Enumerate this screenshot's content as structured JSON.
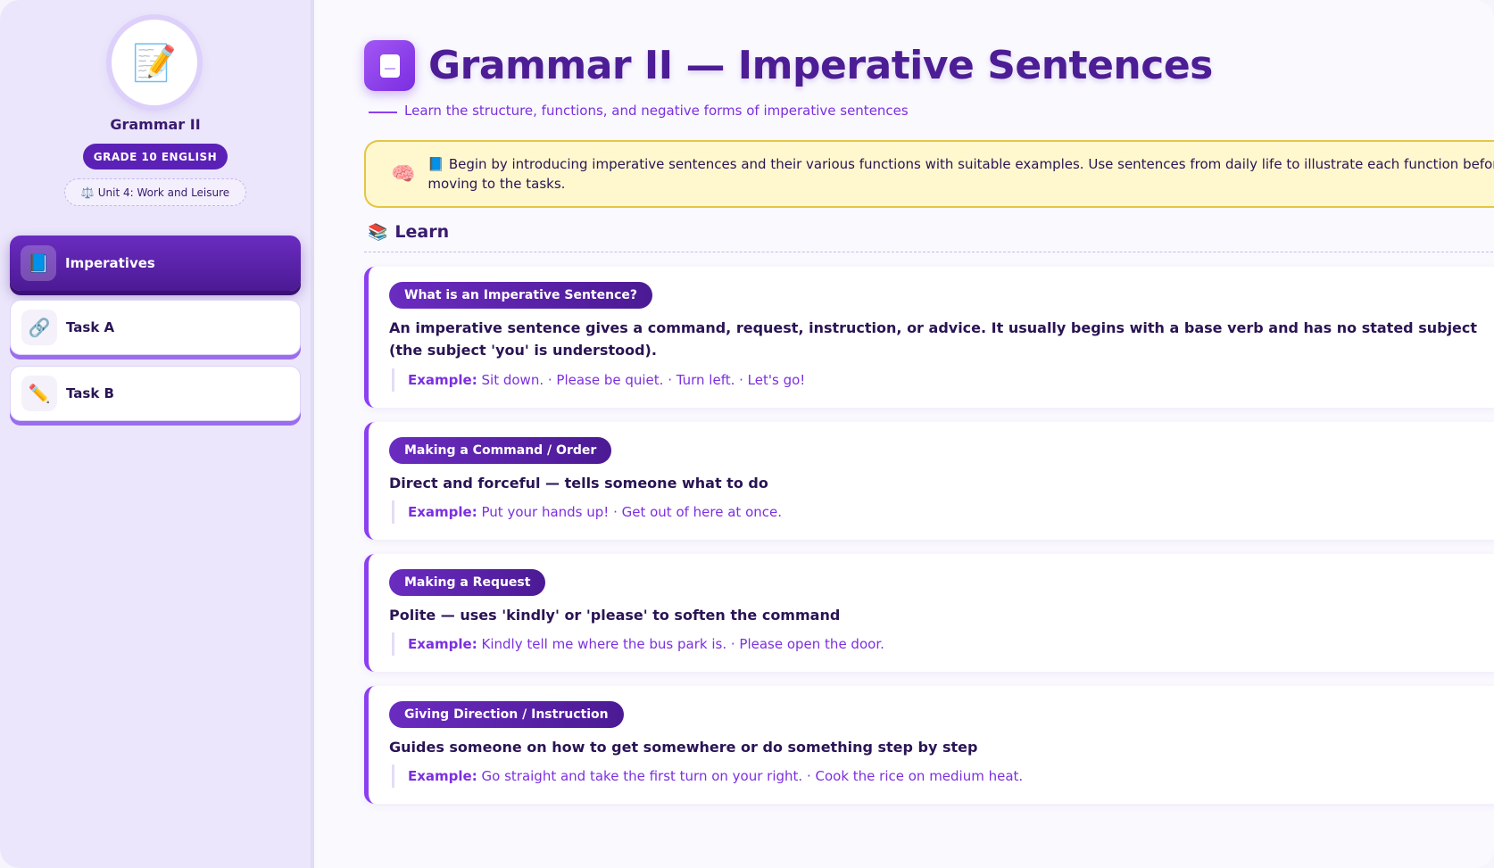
{
  "sidebar": {
    "app_title": "Grammar II",
    "grade": "GRADE 10 ENGLISH",
    "unit": "Unit 4: Work and Leisure",
    "unit_icon": "⚖️",
    "avatar_icon": "📝",
    "items": [
      {
        "label": "Imperatives",
        "icon": "📘",
        "active": true
      },
      {
        "label": "Task A",
        "icon": "🔗",
        "active": false
      },
      {
        "label": "Task B",
        "icon": "✏️",
        "active": false
      }
    ]
  },
  "main": {
    "title": "Grammar II — Imperative Sentences",
    "subtitle": "Learn the structure, functions, and negative forms of imperative sentences",
    "tip_icon": "🧠",
    "tip": "📘 Begin by introducing imperative sentences and their various functions with suitable examples. Use sentences from daily life to illustrate each function before moving to the tasks.",
    "section": {
      "icon": "📚",
      "label": "Learn"
    },
    "example_label": "Example:",
    "cards": [
      {
        "tag": "What is an Imperative Sentence?",
        "desc": "An imperative sentence gives a command, request, instruction, or advice. It usually begins with a base verb and has no stated subject (the subject 'you' is understood).",
        "example": "Sit down. · Please be quiet. · Turn left. · Let's go!"
      },
      {
        "tag": "Making a Command / Order",
        "desc": "Direct and forceful — tells someone what to do",
        "example": "Put your hands up! · Get out of here at once."
      },
      {
        "tag": "Making a Request",
        "desc": "Polite — uses 'kindly' or 'please' to soften the command",
        "example": "Kindly tell me where the bus park is. · Please open the door."
      },
      {
        "tag": "Giving Direction / Instruction",
        "desc": "Guides someone on how to get somewhere or do something step by step",
        "example": "Go straight and take the first turn on your right. · Cook the rice on medium heat."
      }
    ]
  }
}
